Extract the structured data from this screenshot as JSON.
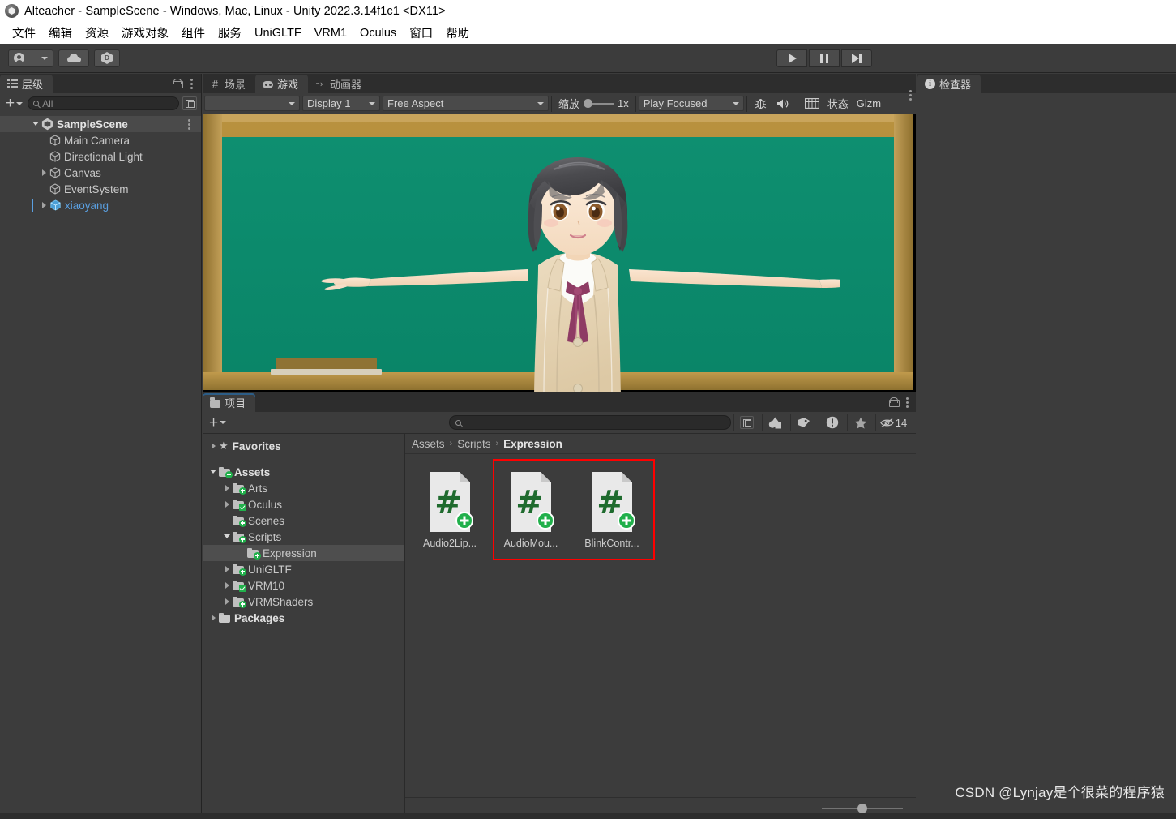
{
  "window": {
    "title": "Alteacher - SampleScene - Windows, Mac, Linux - Unity 2022.3.14f1c1 <DX11>",
    "app_icon": "unity-logo-icon"
  },
  "menubar": {
    "items": [
      "文件",
      "编辑",
      "资源",
      "游戏对象",
      "组件",
      "服务",
      "UniGLTF",
      "VRM1",
      "Oculus",
      "窗口",
      "帮助"
    ]
  },
  "toolbar": {
    "account_icon": "person-icon",
    "account_caret": "chevron-down-icon",
    "cloud_icon": "cloud-icon",
    "services_icon": "unity-services-icon",
    "play_icon": "play-icon",
    "pause_icon": "pause-icon",
    "step_icon": "step-forward-icon"
  },
  "hierarchy": {
    "tab_label": "层级",
    "tab_icon": "hierarchy-list-icon",
    "lock_icon": "lock-icon",
    "menu_icon": "kebab-menu-icon",
    "add_label": "+",
    "search_placeholder": "All",
    "search_icon": "search-icon",
    "filter_icon": "filter-window-icon",
    "tree": [
      {
        "label": "SampleScene",
        "icon": "unity-scene-icon",
        "depth": 0,
        "expanded": true,
        "selected_row": true,
        "bold": true,
        "has_menu": true
      },
      {
        "label": "Main Camera",
        "icon": "gameobject-cube-icon",
        "depth": 2,
        "arrow": "none"
      },
      {
        "label": "Directional Light",
        "icon": "gameobject-cube-icon",
        "depth": 2,
        "arrow": "none"
      },
      {
        "label": "Canvas",
        "icon": "gameobject-cube-icon",
        "depth": 2,
        "arrow": "closed"
      },
      {
        "label": "EventSystem",
        "icon": "gameobject-cube-icon",
        "depth": 2,
        "arrow": "none"
      },
      {
        "label": "xiaoyang",
        "icon": "prefab-icon",
        "depth": 2,
        "arrow": "closed",
        "blue": true,
        "active_marker": true
      }
    ]
  },
  "game_panel": {
    "tabs": [
      {
        "label": "场景",
        "icon": "scene-grid-icon",
        "active": false
      },
      {
        "label": "游戏",
        "icon": "gamepad-icon",
        "active": true
      },
      {
        "label": "动画器",
        "icon": "animator-icon",
        "active": false
      }
    ],
    "menu_icon": "kebab-menu-icon",
    "toolbar": {
      "target_dropdown_value": "",
      "display_dropdown": "Display 1",
      "aspect_dropdown": "Free Aspect",
      "scale_label": "缩放",
      "scale_value": "1x",
      "play_mode_dropdown": "Play Focused",
      "mute_icon": "audio-speaker-icon",
      "bug_icon": "debug-bug-icon",
      "stats_icon": "stats-grid-icon",
      "stats_label": "状态",
      "gizmos_label": "Gizm",
      "caret_icon": "chevron-down-icon"
    },
    "scene_content": {
      "description": "blackboard-classroom-with-vrm-character",
      "board_color": "#0b8a6a",
      "frame_color": "#b9923f",
      "character": "xiaoyang T-pose anime schoolgirl",
      "hair_color": "#4a4a4a",
      "skin_color": "#f6ddc6",
      "blazer_color": "#e3d2b4",
      "ribbon_color": "#8e3b64"
    }
  },
  "project_panel": {
    "tab_label": "项目",
    "tab_icon": "folder-icon",
    "lock_icon": "lock-icon",
    "menu_icon": "kebab-menu-icon",
    "add_label": "+",
    "search_placeholder": "",
    "search_icon": "search-icon",
    "toolbar_icons": [
      {
        "name": "open-in-window-icon"
      },
      {
        "name": "shapes-filter-icon"
      },
      {
        "name": "label-tag-icon"
      },
      {
        "name": "warning-exclamation-icon"
      },
      {
        "name": "favorite-star-icon"
      },
      {
        "name": "hidden-eye-icon"
      }
    ],
    "hidden_count": "14",
    "breadcrumb": [
      "Assets",
      "Scripts",
      "Expression"
    ],
    "breadcrumb_sep": "›",
    "favorites_label": "Favorites",
    "favorites_icon": "star-icon",
    "tree": [
      {
        "label": "Assets",
        "depth": 0,
        "arrow": "open",
        "badge": "plus",
        "bold": true
      },
      {
        "label": "Arts",
        "depth": 1,
        "arrow": "closed",
        "badge": "plus"
      },
      {
        "label": "Oculus",
        "depth": 1,
        "arrow": "closed",
        "badge": "check"
      },
      {
        "label": "Scenes",
        "depth": 1,
        "arrow": "none",
        "badge": "plus"
      },
      {
        "label": "Scripts",
        "depth": 1,
        "arrow": "open",
        "badge": "plus"
      },
      {
        "label": "Expression",
        "depth": 2,
        "arrow": "none",
        "badge": "plus",
        "selected": true
      },
      {
        "label": "UniGLTF",
        "depth": 1,
        "arrow": "closed",
        "badge": "plus"
      },
      {
        "label": "VRM10",
        "depth": 1,
        "arrow": "closed",
        "badge": "check"
      },
      {
        "label": "VRMShaders",
        "depth": 1,
        "arrow": "closed",
        "badge": "plus"
      },
      {
        "label": "Packages",
        "depth": 0,
        "arrow": "closed",
        "badge": "none",
        "bold": true
      }
    ],
    "assets": [
      {
        "name": "Audio2Lip...",
        "icon": "csharp-script-icon",
        "badge": "plus",
        "highlighted": false
      },
      {
        "name": "AudioMou...",
        "icon": "csharp-script-icon",
        "badge": "plus",
        "highlighted": true
      },
      {
        "name": "BlinkContr...",
        "icon": "csharp-script-icon",
        "badge": "plus",
        "highlighted": true
      }
    ],
    "annotation": {
      "shape": "rectangle",
      "color": "#ff0000"
    },
    "zoom_slider_icon": "icon-size-slider"
  },
  "inspector": {
    "tab_label": "检查器",
    "tab_icon": "info-icon"
  },
  "watermark": {
    "text": "CSDN @Lynjay是个很菜的程序猿"
  }
}
